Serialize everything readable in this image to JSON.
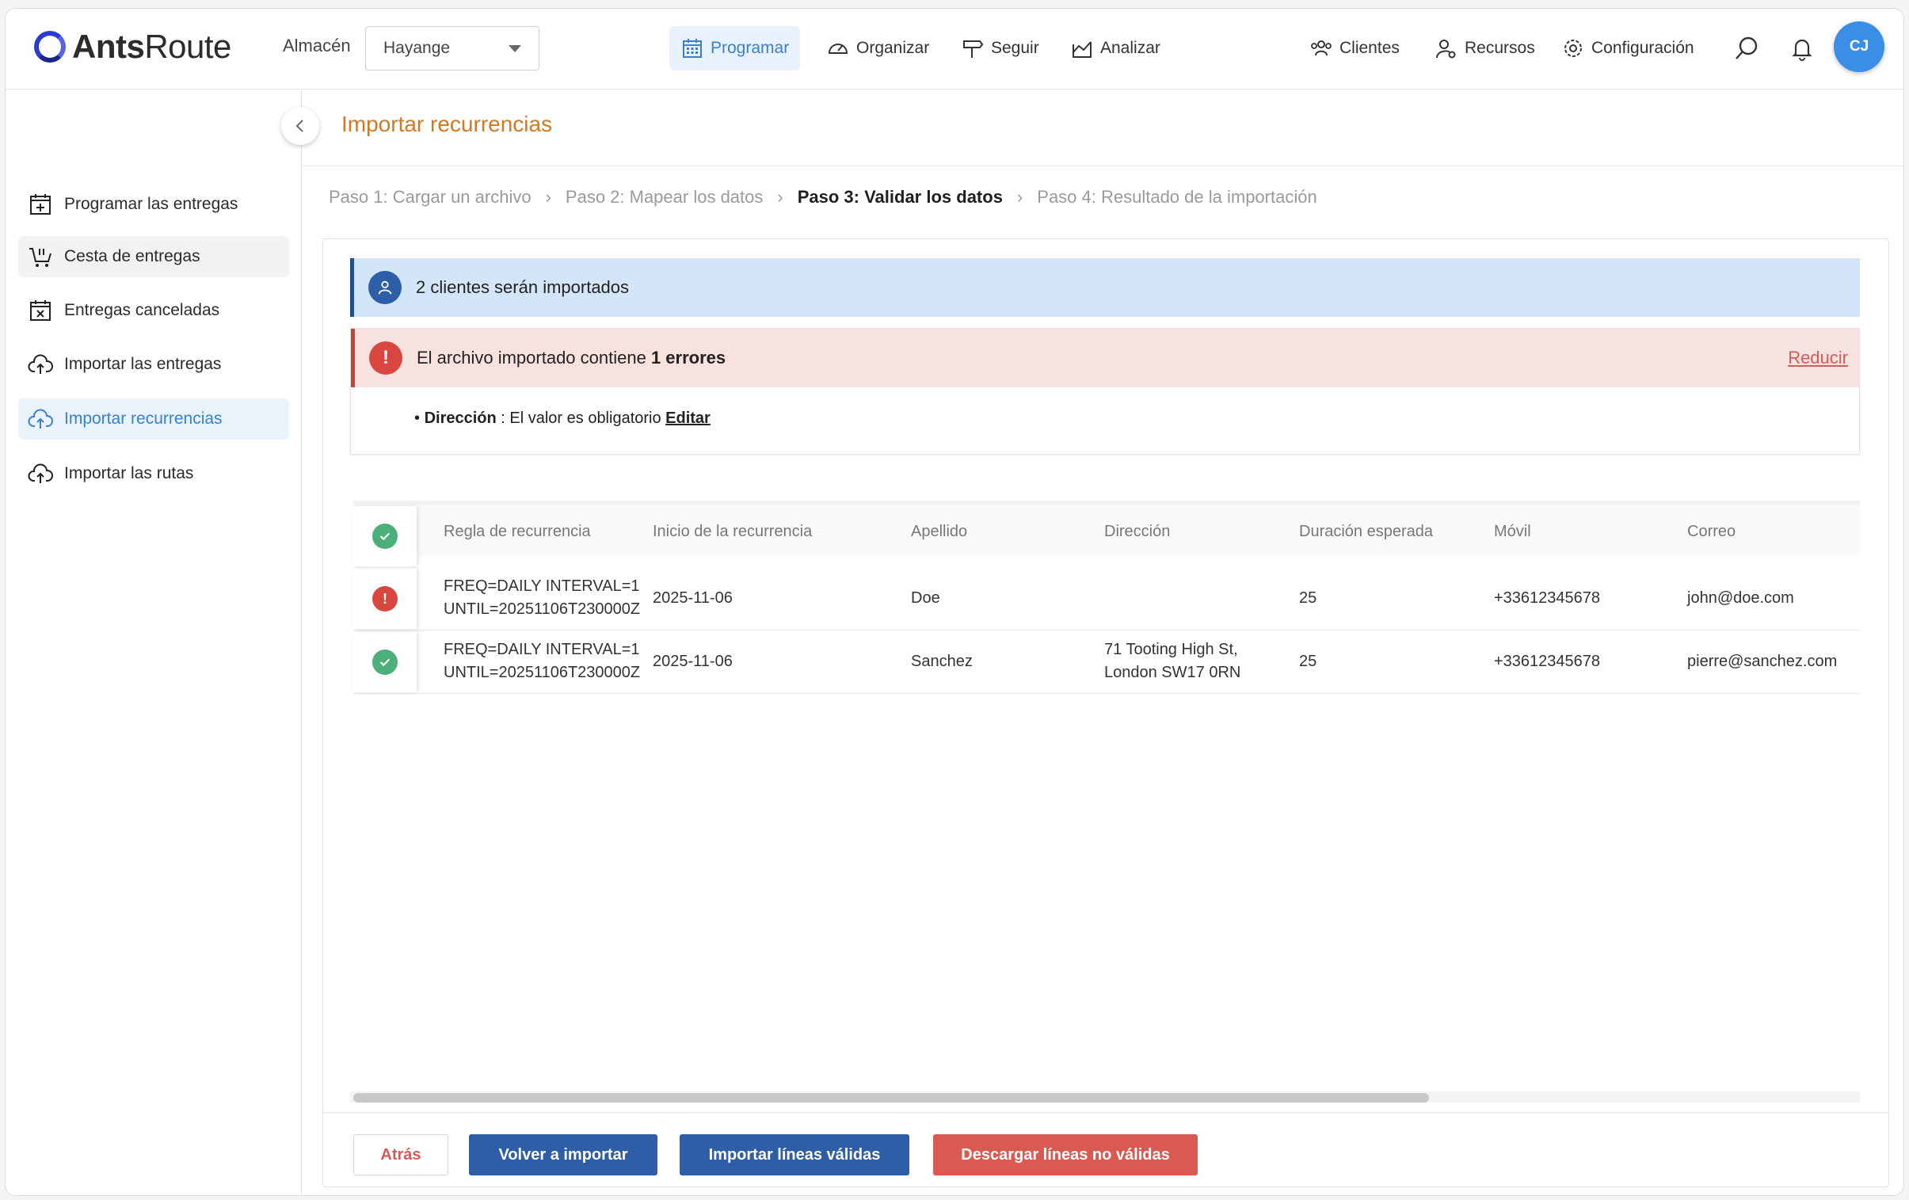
{
  "app": {
    "logo_bold": "Ants",
    "logo_light": "Route",
    "warehouse_label": "Almacén",
    "warehouse_value": "Hayange"
  },
  "nav": {
    "programar": "Programar",
    "organizar": "Organizar",
    "seguir": "Seguir",
    "analizar": "Analizar",
    "clientes": "Clientes",
    "recursos": "Recursos",
    "configuracion": "Configuración",
    "avatar": "CJ"
  },
  "sidebar": {
    "items": [
      {
        "label": "Programar las entregas",
        "icon": "calendar-plus-icon"
      },
      {
        "label": "Cesta de entregas",
        "icon": "cart-icon"
      },
      {
        "label": "Entregas canceladas",
        "icon": "calendar-x-icon"
      },
      {
        "label": "Importar las entregas",
        "icon": "cloud-upload-icon"
      },
      {
        "label": "Importar recurrencias",
        "icon": "cloud-upload-icon"
      },
      {
        "label": "Importar las rutas",
        "icon": "cloud-upload-icon"
      }
    ]
  },
  "page": {
    "title": "Importar recurrencias",
    "steps": [
      "Paso 1: Cargar un archivo",
      "Paso 2: Mapear los datos",
      "Paso 3: Validar los datos",
      "Paso 4: Resultado de la importación"
    ]
  },
  "info": {
    "text": "2 clientes serán importados"
  },
  "errors": {
    "text_before": "El archivo importado contiene ",
    "text_count": "1 errores",
    "reduce_link": "Reducir",
    "item_field": "Dirección",
    "item_message": " : El valor es obligatorio ",
    "item_edit": "Editar"
  },
  "table": {
    "headers": [
      "Regla de recurrencia",
      "Inicio de la recurrencia",
      "Apellido",
      "Dirección",
      "Duración esperada",
      "Móvil",
      "Correo"
    ],
    "rows": [
      {
        "status": "error",
        "rule_l1": "FREQ=DAILY INTERVAL=1",
        "rule_l2": "UNTIL=20251106T230000Z",
        "start": "2025-11-06",
        "surname": "Doe",
        "address_l1": "",
        "address_l2": "",
        "duration": "25",
        "mobile": "+33612345678",
        "email": "john@doe.com"
      },
      {
        "status": "ok",
        "rule_l1": "FREQ=DAILY INTERVAL=1",
        "rule_l2": "UNTIL=20251106T230000Z",
        "start": "2025-11-06",
        "surname": "Sanchez",
        "address_l1": "71 Tooting High St,",
        "address_l2": "London SW17 0RN",
        "duration": "25",
        "mobile": "+33612345678",
        "email": "pierre@sanchez.com"
      }
    ]
  },
  "footer": {
    "back": "Atrás",
    "reimport": "Volver a importar",
    "import_valid": "Importar líneas válidas",
    "download_invalid": "Descargar líneas no válidas"
  },
  "colors": {
    "accent_blue": "#3a7fd0",
    "title_orange": "#d5781f",
    "ok_green": "#4caf7a",
    "error_red": "#d9463f",
    "button_blue": "#2f5ea8",
    "button_red": "#da5a52"
  }
}
